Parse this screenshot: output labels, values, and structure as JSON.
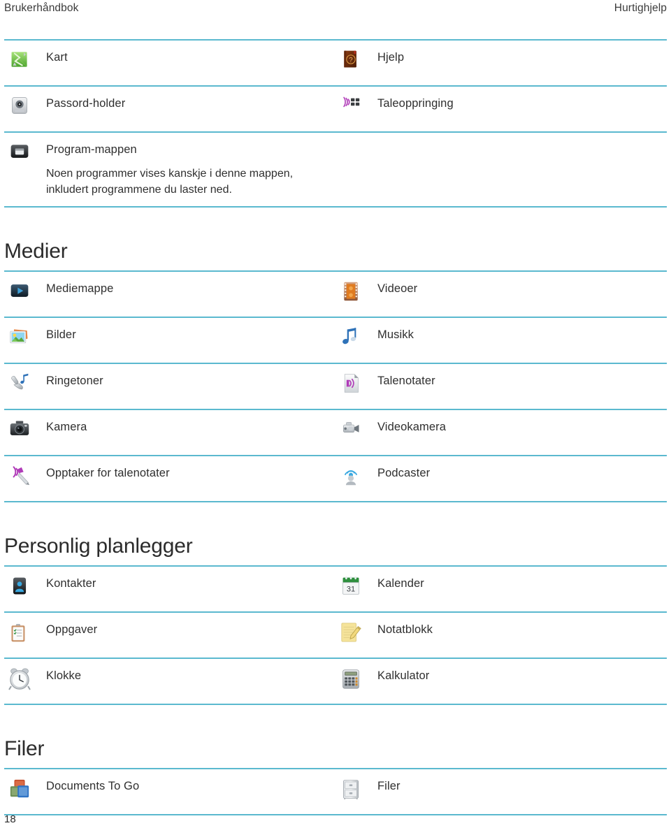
{
  "running_head": {
    "left": "Brukerhåndbok",
    "right": "Hurtighjelp"
  },
  "colors": {
    "rule": "#5bb9cf",
    "text": "#2f2f2f",
    "heading": "#2b2b2b"
  },
  "folio": "18",
  "sections": [
    {
      "id": "section-top",
      "heading": null,
      "rows": [
        {
          "left": {
            "label": "Kart",
            "icon": "maps-icon"
          },
          "right": {
            "label": "Hjelp",
            "icon": "help-book-icon"
          }
        },
        {
          "left": {
            "label": "Passord-holder",
            "icon": "password-keeper-icon"
          },
          "right": {
            "label": "Taleoppringing",
            "icon": "voice-dialing-icon"
          }
        },
        {
          "left": {
            "label": "Program-mappen",
            "icon": "applications-folder-icon",
            "description": "Noen programmer vises kanskje i denne mappen, inkludert programmene du laster ned."
          },
          "right": null
        }
      ]
    },
    {
      "id": "section-medier",
      "heading": "Medier",
      "rows": [
        {
          "left": {
            "label": "Mediemappe",
            "icon": "media-folder-icon"
          },
          "right": {
            "label": "Videoer",
            "icon": "videos-icon"
          }
        },
        {
          "left": {
            "label": "Bilder",
            "icon": "pictures-icon"
          },
          "right": {
            "label": "Musikk",
            "icon": "music-icon"
          }
        },
        {
          "left": {
            "label": "Ringetoner",
            "icon": "ringtones-icon"
          },
          "right": {
            "label": "Talenotater",
            "icon": "voice-notes-icon"
          }
        },
        {
          "left": {
            "label": "Kamera",
            "icon": "camera-icon"
          },
          "right": {
            "label": "Videokamera",
            "icon": "video-camera-icon"
          }
        },
        {
          "left": {
            "label": "Opptaker for talenotater",
            "icon": "voice-note-recorder-icon"
          },
          "right": {
            "label": "Podcaster",
            "icon": "podcasts-icon"
          }
        }
      ]
    },
    {
      "id": "section-personlig-planlegger",
      "heading": "Personlig planlegger",
      "rows": [
        {
          "left": {
            "label": "Kontakter",
            "icon": "contacts-icon"
          },
          "right": {
            "label": "Kalender",
            "icon": "calendar-icon"
          }
        },
        {
          "left": {
            "label": "Oppgaver",
            "icon": "tasks-icon"
          },
          "right": {
            "label": "Notatblokk",
            "icon": "memopad-icon"
          }
        },
        {
          "left": {
            "label": "Klokke",
            "icon": "clock-icon"
          },
          "right": {
            "label": "Kalkulator",
            "icon": "calculator-icon"
          }
        }
      ]
    },
    {
      "id": "section-filer",
      "heading": "Filer",
      "rows": [
        {
          "left": {
            "label": "Documents To Go",
            "icon": "documents-to-go-icon"
          },
          "right": {
            "label": "Filer",
            "icon": "files-cabinet-icon"
          }
        }
      ]
    }
  ]
}
